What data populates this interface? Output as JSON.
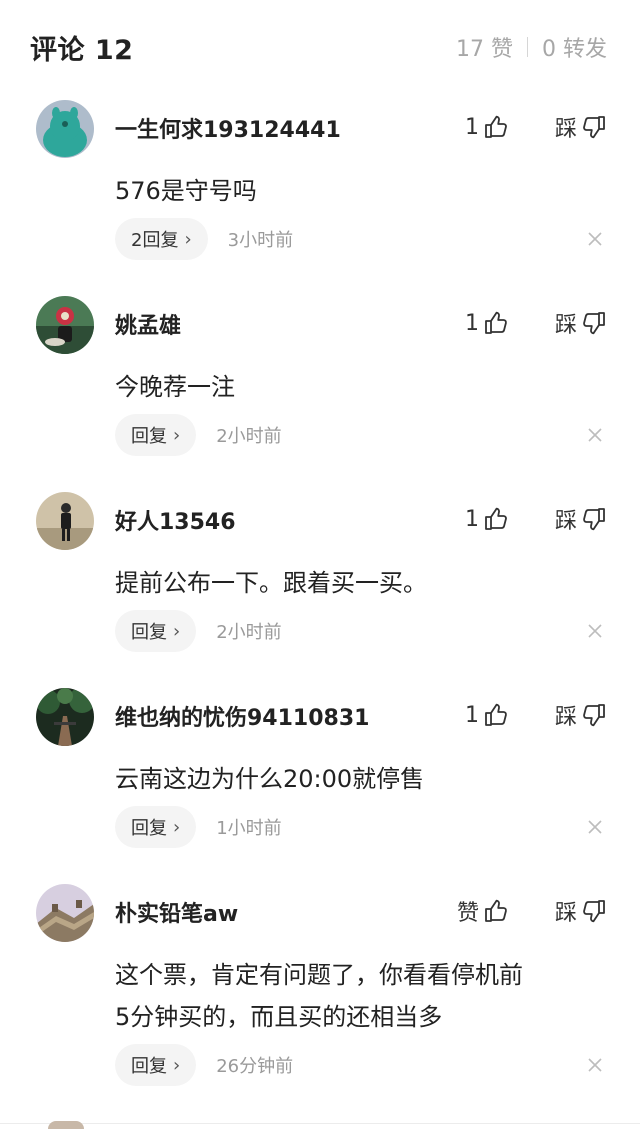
{
  "header": {
    "title": "评论 12",
    "likes": "17 赞",
    "shares": "0 转发"
  },
  "comments": [
    {
      "username": "一生何求193124441",
      "like_label": "1",
      "dislike_label": "踩",
      "text": "576是守号吗",
      "reply_label": "2回复",
      "time": "3小时前",
      "avatar": "teal-cartoon-avatar"
    },
    {
      "username": "姚孟雄",
      "like_label": "1",
      "dislike_label": "踩",
      "text": "今晚荐一注",
      "reply_label": "回复",
      "time": "2小时前",
      "avatar": "flower-vase-avatar"
    },
    {
      "username": "好人13546",
      "like_label": "1",
      "dislike_label": "踩",
      "text": "提前公布一下。跟着买一买。",
      "reply_label": "回复",
      "time": "2小时前",
      "avatar": "person-photo-avatar"
    },
    {
      "username": "维也纳的忧伤94110831",
      "like_label": "1",
      "dislike_label": "踩",
      "text": "云南这边为什么20:00就停售",
      "reply_label": "回复",
      "time": "1小时前",
      "avatar": "forest-path-avatar"
    },
    {
      "username": "朴实铅笔aw",
      "like_label": "赞",
      "dislike_label": "踩",
      "text_lines": [
        "这个票，肯定有问题了，你看看停机前",
        "5分钟买的，而且买的还相当多"
      ],
      "reply_label": "回复",
      "time": "26分钟前",
      "avatar": "great-wall-avatar"
    }
  ],
  "icons": {
    "like": "thumbs-up-icon",
    "dislike": "thumbs-down-icon",
    "close": "close-icon",
    "reply_chevron": "chevron-right-icon"
  },
  "colors": {
    "text": "#222222",
    "muted": "#9a9a9a",
    "pill": "#f4f4f4",
    "avatar_teal": "#2ea79b"
  }
}
